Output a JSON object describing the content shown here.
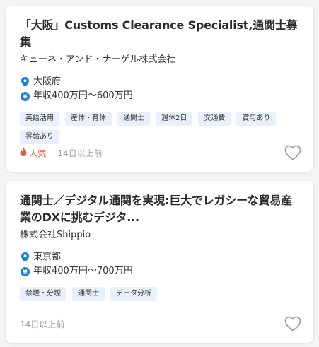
{
  "jobs": [
    {
      "title": "「大阪」Customs Clearance Specialist,通関士募集",
      "company": "キューネ・アンド・ナーゲル株式会社",
      "location": "大阪府",
      "salary": "年収400万円～600万円",
      "tags": [
        "英語活用",
        "産休・育休",
        "通関士",
        "週休2日",
        "交通費",
        "賞与あり",
        "昇給あり"
      ],
      "popular": "人気",
      "posted": "14日以上前"
    },
    {
      "title_line1": "通関士／デジタル通関を実現:巨大でレガシーな貿易産",
      "title_line2": "業のDXに挑むデジタ...",
      "company": "株式会社Shippio",
      "location": "東京都",
      "salary": "年収400万円～700万円",
      "tags": [
        "禁煙・分煙",
        "通関士",
        "データ分析"
      ],
      "posted": "14日以上前"
    }
  ],
  "icons": {
    "location": "map-pin-icon",
    "salary": "yen-coin-icon",
    "popular": "flame-icon",
    "favorite": "heart-outline-icon"
  },
  "colors": {
    "accent": "#1a7fd4",
    "hot": "#e8563a",
    "tag_bg": "#e8f1fb",
    "muted": "#9aa0a6"
  }
}
